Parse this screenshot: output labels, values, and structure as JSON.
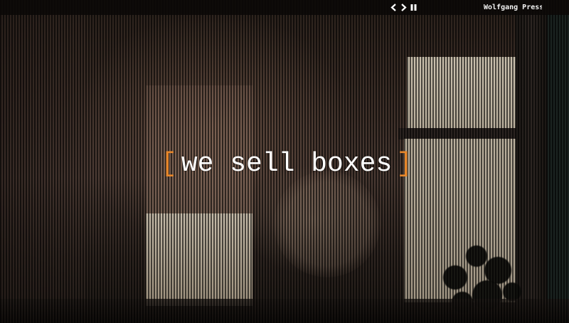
{
  "header": {
    "brand": "Wolfgang Press",
    "controls": [
      {
        "name": "prev-slide",
        "icon": "chevron-left-icon"
      },
      {
        "name": "next-slide",
        "icon": "chevron-right-icon"
      },
      {
        "name": "pause-slideshow",
        "icon": "pause-icon"
      }
    ]
  },
  "hero": {
    "bracket_open": "[",
    "tagline": "we sell boxes",
    "bracket_close": "]"
  },
  "colors": {
    "accent": "#e8872a",
    "text": "#ffffff",
    "bar": "#0a0807"
  }
}
